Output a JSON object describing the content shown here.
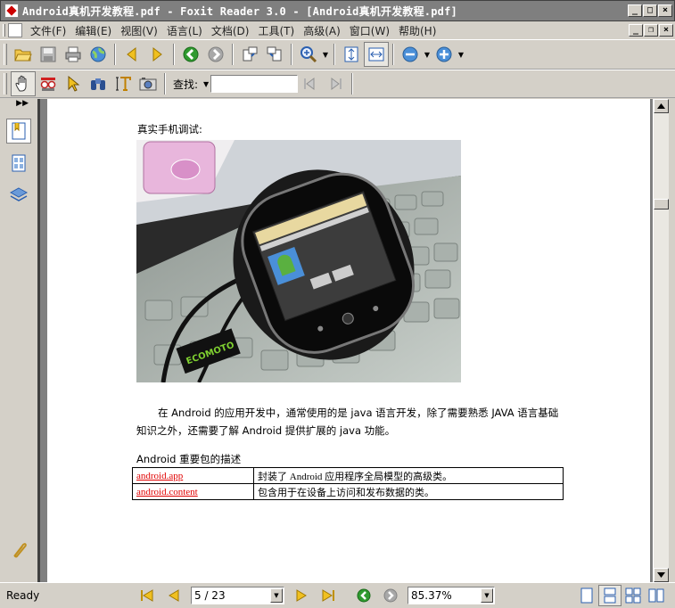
{
  "window": {
    "title": "Android真机开发教程.pdf - Foxit Reader 3.0 - [Android真机开发教程.pdf]",
    "buttons": {
      "minimize": "_",
      "maximize": "□",
      "close": "×"
    }
  },
  "menu": {
    "items": [
      "文件(F)",
      "编辑(E)",
      "视图(V)",
      "语言(L)",
      "文档(D)",
      "工具(T)",
      "高级(A)",
      "窗口(W)",
      "帮助(H)"
    ],
    "mdi_buttons": {
      "minimize": "_",
      "restore": "❐",
      "close": "×"
    }
  },
  "toolbar2": {
    "find_label": "查找:",
    "find_value": ""
  },
  "document": {
    "caption": "真实手机调试:",
    "photo_logo": "ECOMOTO",
    "paragraph": "在 Android 的应用开发中，通常使用的是 java 语言开发，除了需要熟悉 JAVA 语言基础知识之外，还需要了解 Android 提供扩展的 java 功能。",
    "table_title": "Android 重要包的描述",
    "table_rows": [
      {
        "name": "android.app",
        "desc": "封装了 Android 应用程序全局模型的高级类。"
      },
      {
        "name": "android.content",
        "desc": "包含用于在设备上访问和发布数据的类。"
      }
    ]
  },
  "statusbar": {
    "status": "Ready",
    "page_indicator": "5 / 23",
    "zoom": "85.37%"
  },
  "colors": {
    "accent_green": "#2f9a2f",
    "link_red": "#e00000",
    "title_bar": "#7f7f7f"
  }
}
